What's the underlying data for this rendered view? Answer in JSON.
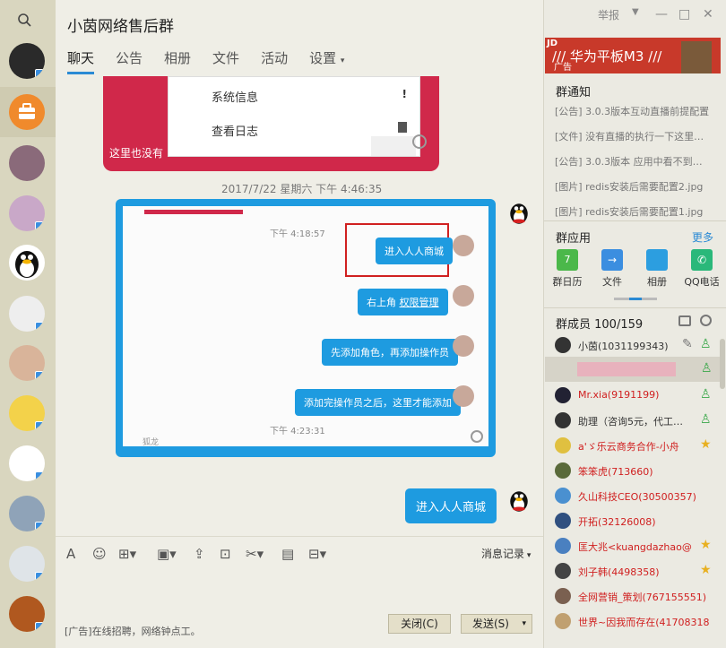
{
  "window": {
    "title": "小茵网络售后群",
    "report": "举报",
    "min": "—",
    "max": "□",
    "close": "✕"
  },
  "tabs": [
    "聊天",
    "公告",
    "相册",
    "文件",
    "活动",
    "设置"
  ],
  "chat": {
    "card_menu": [
      "系统信息",
      "查看日志"
    ],
    "card_note": "这里也没有",
    "timestamp": "2017/7/22 星期六 下午 4:46:35",
    "inner": {
      "time1": "下午 4:18:57",
      "msgs": [
        "进入人人商城",
        "右上角",
        "权限管理",
        "先添加角色，再添加操作员",
        "添加完操作员之后，这里才能添加"
      ],
      "time2": "下午 4:23:31",
      "footer_name": "狐龙"
    },
    "last_msg": "进入人人商城"
  },
  "toolbar": {
    "history": "消息记录"
  },
  "input": {
    "ad": "[广告]在线招聘，网络钟点工。",
    "close": "关闭(C)",
    "send": "发送(S)"
  },
  "ad_banner": {
    "brand": "JD",
    "text": "/// 华为平板M3 ///",
    "tag": "广告"
  },
  "notices": {
    "title": "群通知",
    "items": [
      "[公告] 3.0.3版本互动直播前提配置",
      "[文件] 没有直播的执行一下这里…",
      "[公告] 3.0.3版本 应用中看不到…",
      "[图片] redis安装后需要配置2.jpg",
      "[图片] redis安装后需要配置1.jpg"
    ]
  },
  "apps": {
    "title": "群应用",
    "more": "更多",
    "items": [
      "群日历",
      "文件",
      "相册",
      "QQ电话"
    ]
  },
  "members": {
    "title": "群成员 100/159",
    "list": [
      "小茵(1031199343)",
      "",
      "Mr.xia(9191199)",
      "助理（咨询5元，代工…",
      "a'ゞ乐云商务合作-小舟",
      "笨笨虎(713660)",
      "久山科技CEO(30500357)",
      "开拓(32126008)",
      "匡大兆<kuangdazhao@",
      "刘子韩(4498358)",
      "全网营销_策划(767155551)",
      "世界~因我而存在(41708318"
    ]
  },
  "colors": {
    "accent": "#2a8ad4",
    "bubble": "#1e9be0",
    "red_card": "#d0284a"
  }
}
